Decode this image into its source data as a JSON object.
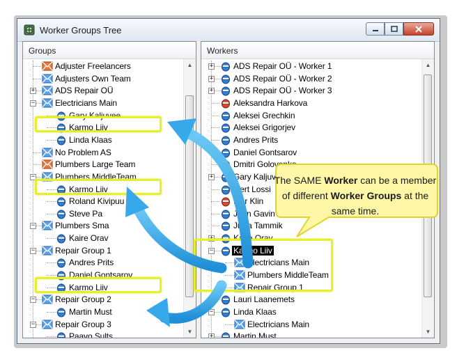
{
  "window": {
    "title": "Worker Groups Tree"
  },
  "groups_panel": {
    "header": "Groups",
    "items": [
      {
        "label": "Adjuster Freelancers",
        "level": 0,
        "icon": "orange",
        "expander": ""
      },
      {
        "label": "Adjusters Own Team",
        "level": 0,
        "icon": "blue",
        "expander": ""
      },
      {
        "label": "ADS Repair OÜ",
        "level": 0,
        "icon": "blue",
        "expander": "+"
      },
      {
        "label": "Electricians Main",
        "level": 0,
        "icon": "blue",
        "expander": "-"
      },
      {
        "label": "Gary Kaljuvee",
        "level": 1,
        "icon": "person-blue",
        "expander": ""
      },
      {
        "label": "Karmo Liiv",
        "level": 1,
        "icon": "person-blue",
        "expander": ""
      },
      {
        "label": "Linda Klaas",
        "level": 1,
        "icon": "person-blue",
        "expander": ""
      },
      {
        "label": "No Problem AS",
        "level": 0,
        "icon": "blue",
        "expander": ""
      },
      {
        "label": "Plumbers Large Team",
        "level": 0,
        "icon": "orange",
        "expander": ""
      },
      {
        "label": "Plumbers MiddleTeam",
        "level": 0,
        "icon": "blue",
        "expander": "-"
      },
      {
        "label": "Karmo Liiv",
        "level": 1,
        "icon": "person-blue",
        "expander": ""
      },
      {
        "label": "Roland Kivipuu",
        "level": 1,
        "icon": "person-blue",
        "expander": ""
      },
      {
        "label": "Steve Pa",
        "level": 1,
        "icon": "person-blue",
        "expander": ""
      },
      {
        "label": "Plumbers Sma",
        "level": 0,
        "icon": "blue",
        "expander": "-"
      },
      {
        "label": "Kaire Orav",
        "level": 1,
        "icon": "person-blue",
        "expander": ""
      },
      {
        "label": "Repair Group 1",
        "level": 0,
        "icon": "blue",
        "expander": "-"
      },
      {
        "label": "Andres Prits",
        "level": 1,
        "icon": "person-blue",
        "expander": ""
      },
      {
        "label": "Daniel Gontsarov",
        "level": 1,
        "icon": "person-blue",
        "expander": ""
      },
      {
        "label": "Karmo Liiv",
        "level": 1,
        "icon": "person-blue",
        "expander": ""
      },
      {
        "label": "Repair Group 2",
        "level": 0,
        "icon": "blue",
        "expander": "-"
      },
      {
        "label": "Martin Must",
        "level": 1,
        "icon": "person-blue",
        "expander": ""
      },
      {
        "label": "Repair Group 3",
        "level": 0,
        "icon": "blue",
        "expander": "-"
      },
      {
        "label": "Paavo Sults",
        "level": 1,
        "icon": "person-blue",
        "expander": ""
      }
    ]
  },
  "workers_panel": {
    "header": "Workers",
    "items": [
      {
        "label": "ADS Repair OÜ - Worker 1",
        "level": 0,
        "icon": "person-blue",
        "expander": "+"
      },
      {
        "label": "ADS Repair OÜ - Worker 2",
        "level": 0,
        "icon": "person-blue",
        "expander": "+"
      },
      {
        "label": "ADS Repair OÜ - Worker 3",
        "level": 0,
        "icon": "person-blue",
        "expander": "+"
      },
      {
        "label": "Aleksandra Harkova",
        "level": 0,
        "icon": "person-red",
        "expander": ""
      },
      {
        "label": "Aleksei Grechkin",
        "level": 0,
        "icon": "person-blue",
        "expander": ""
      },
      {
        "label": "Aleksei Grigorjev",
        "level": 0,
        "icon": "person-blue",
        "expander": ""
      },
      {
        "label": "Andres Prits",
        "level": 0,
        "icon": "person-blue",
        "expander": ""
      },
      {
        "label": "Daniel Gontsarov",
        "level": 0,
        "icon": "person-blue",
        "expander": ""
      },
      {
        "label": "Dmitri Golovenko",
        "level": 0,
        "icon": "person-blue",
        "expander": ""
      },
      {
        "label": "Gary Kaljuvee",
        "level": 0,
        "icon": "person-blue",
        "expander": "+"
      },
      {
        "label": "Gert Lossi",
        "level": 0,
        "icon": "person-blue",
        "expander": ""
      },
      {
        "label": "Igor Klin",
        "level": 0,
        "icon": "person-red",
        "expander": ""
      },
      {
        "label": "Jaan Gavin",
        "level": 0,
        "icon": "person-blue",
        "expander": ""
      },
      {
        "label": "Julija Tammik",
        "level": 0,
        "icon": "person-blue",
        "expander": ""
      },
      {
        "label": "Kaire Orav",
        "level": 0,
        "icon": "person-blue",
        "expander": "+"
      },
      {
        "label": "Karmo Liiv",
        "level": 0,
        "icon": "person-blue",
        "expander": "-",
        "selected": true
      },
      {
        "label": "Electricians Main",
        "level": 1,
        "icon": "blue",
        "expander": ""
      },
      {
        "label": "Plumbers MiddleTeam",
        "level": 1,
        "icon": "blue",
        "expander": ""
      },
      {
        "label": "Repair Group 1",
        "level": 1,
        "icon": "blue",
        "expander": ""
      },
      {
        "label": "Lauri Laanemets",
        "level": 0,
        "icon": "person-blue",
        "expander": "+"
      },
      {
        "label": "Linda Klaas",
        "level": 0,
        "icon": "person-blue",
        "expander": "-"
      },
      {
        "label": "Electricians Main",
        "level": 1,
        "icon": "blue",
        "expander": ""
      },
      {
        "label": "Martin Must",
        "level": 0,
        "icon": "person-blue",
        "expander": "+"
      }
    ]
  },
  "callout": {
    "p1": "The SAME ",
    "b1": "Worker",
    "p2": " can be a member of different ",
    "b2": "Worker Groups",
    "p3": " at the same time."
  },
  "colors": {
    "highlight": "#e6ef2a",
    "arrow": "#2fa3e6",
    "callout_fill": "#fdf7a6",
    "callout_border": "#e2d22d",
    "selection": "#000000"
  }
}
